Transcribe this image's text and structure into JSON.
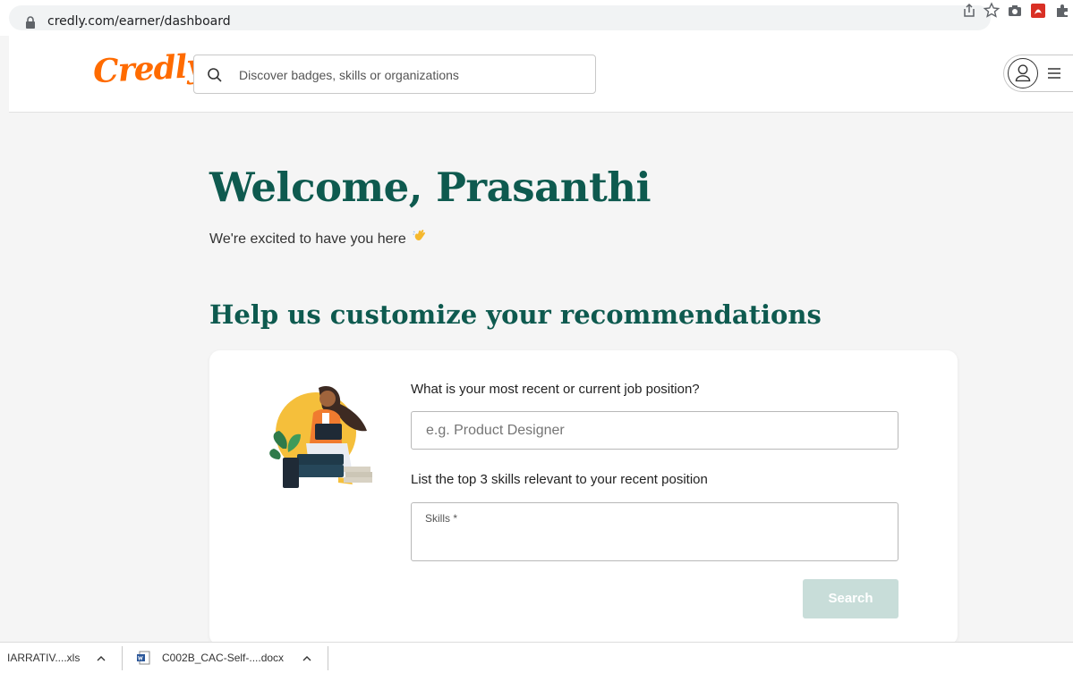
{
  "browser": {
    "url": "credly.com/earner/dashboard",
    "icons": [
      "lock-icon",
      "share-icon",
      "star-icon",
      "camera-icon",
      "pdf-icon",
      "puzzle-icon"
    ]
  },
  "header": {
    "logo": "Credly",
    "search_placeholder": "Discover badges, skills or organizations"
  },
  "main": {
    "welcome_title": "Welcome, Prasanthi",
    "welcome_subtitle": "We're excited to have you here",
    "section_title": "Help us customize your recommendations",
    "form": {
      "job_question": "What is your most recent or current job position?",
      "job_placeholder": "e.g. Product Designer",
      "skills_question": "List the top 3 skills relevant to your recent position",
      "skills_label": "Skills *",
      "search_button": "Search"
    }
  },
  "downloads": {
    "items": [
      "IARRATIV....xls",
      "C002B_CAC-Self-....docx"
    ]
  },
  "colors": {
    "brand_orange": "#ff6b00",
    "heading_green": "#0e5a4f",
    "button_disabled": "#c8ddd9"
  }
}
